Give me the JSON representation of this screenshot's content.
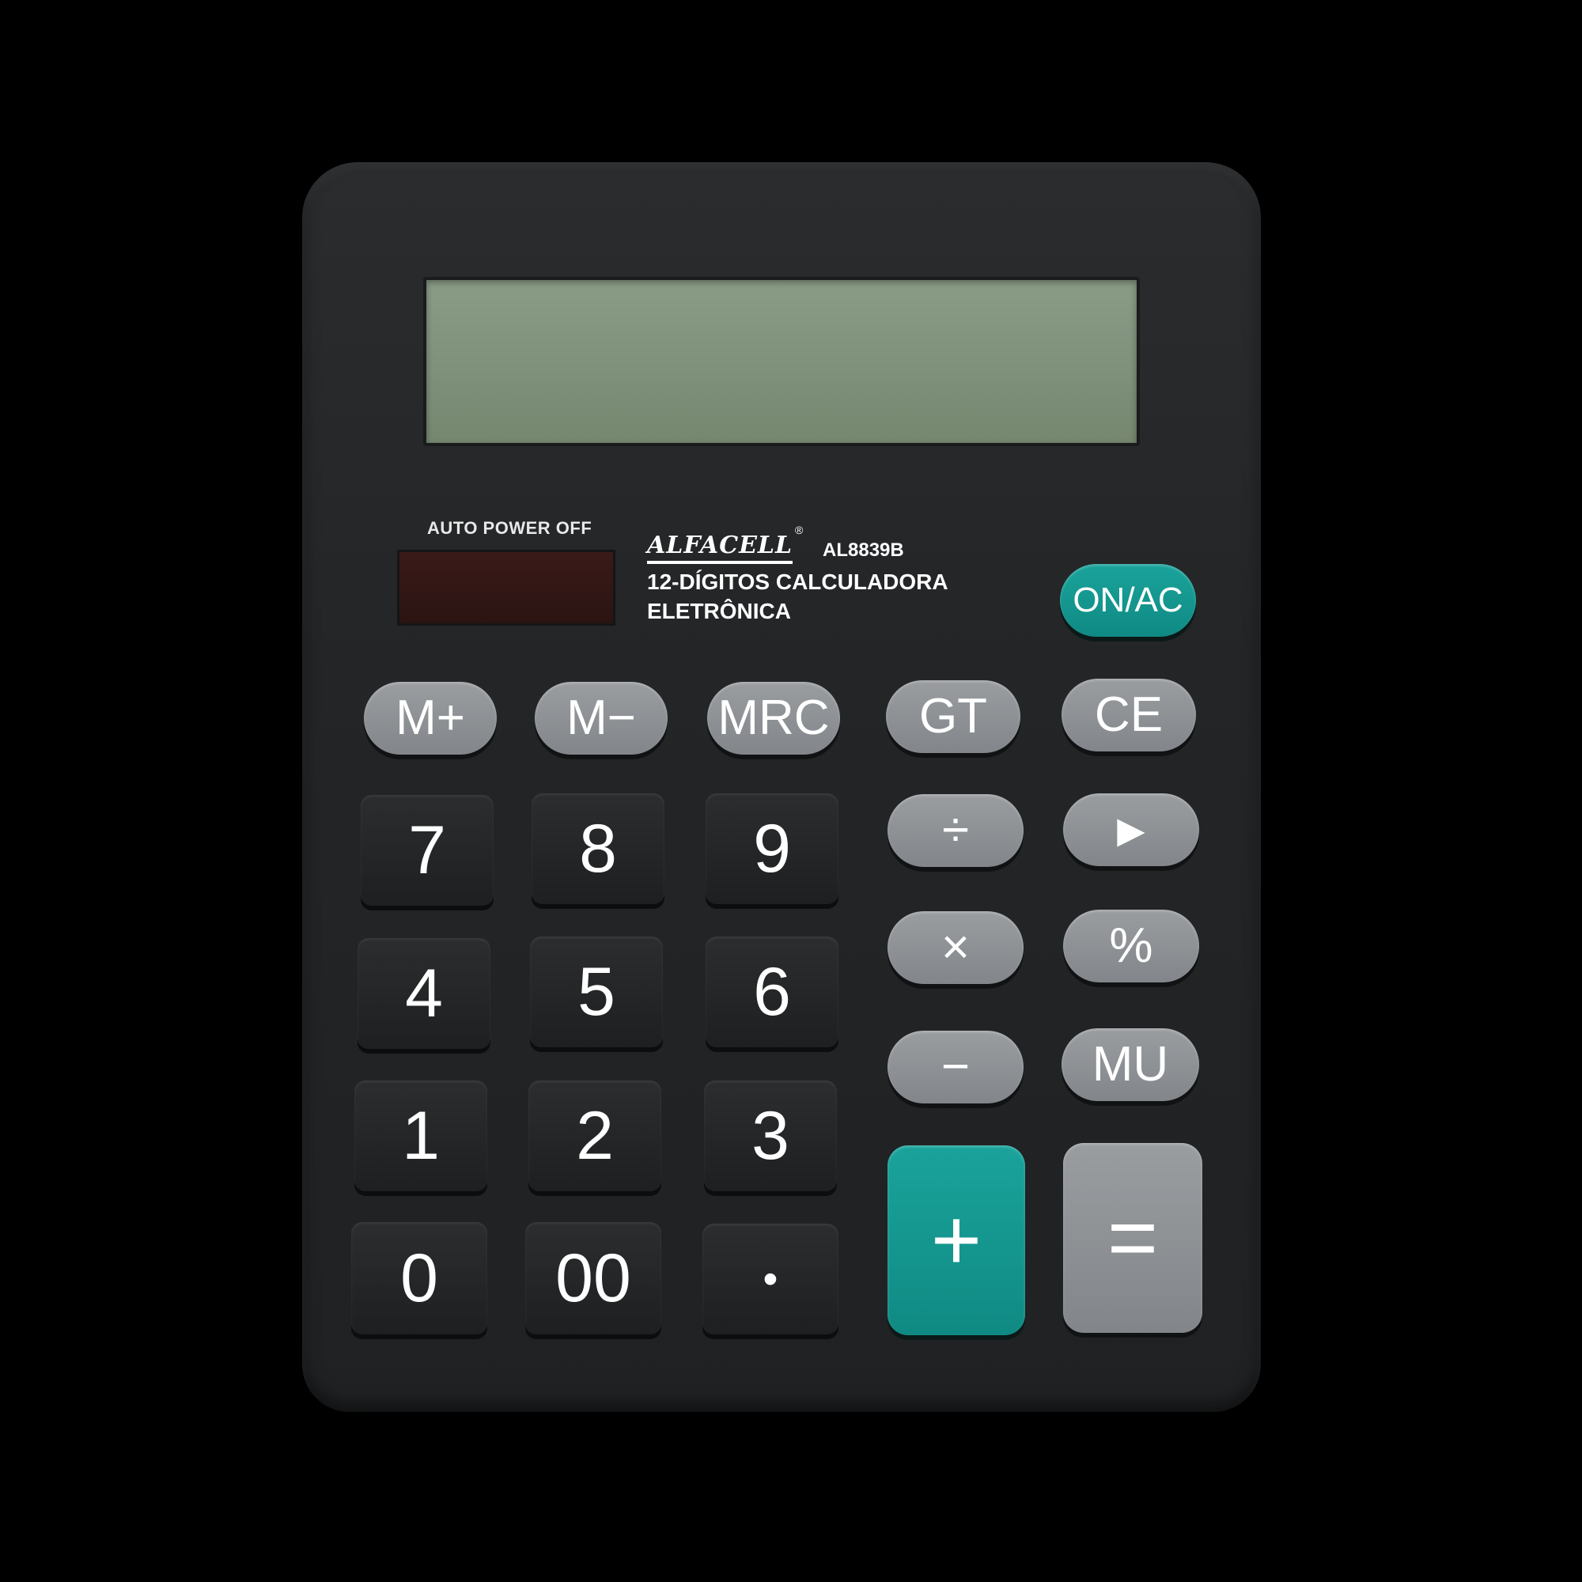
{
  "calculator": {
    "auto_power_off": "AUTO POWER OFF",
    "brand": "ALFACELL",
    "brand_mark": "®",
    "model": "AL8839B",
    "description_line1": "12-DÍGITOS CALCULADORA",
    "description_line2": "ELETRÔNICA",
    "display_value": "",
    "colors": {
      "body": "#232527",
      "lcd": "#7e8f7a",
      "teal_key": "#13958d",
      "gray_key": "#8c9094",
      "black_key": "#1f2123"
    }
  },
  "keys": {
    "on_ac": "ON/AC",
    "m_plus": "M+",
    "m_minus": "M−",
    "mrc": "MRC",
    "gt": "GT",
    "ce": "CE",
    "seven": "7",
    "eight": "8",
    "nine": "9",
    "divide": "÷",
    "backspace": "▶",
    "four": "4",
    "five": "5",
    "six": "6",
    "multiply": "×",
    "percent": "%",
    "one": "1",
    "two": "2",
    "three": "3",
    "minus": "−",
    "mu": "MU",
    "zero": "0",
    "double_zero": "00",
    "decimal": "•",
    "plus": "+",
    "equals": "="
  }
}
